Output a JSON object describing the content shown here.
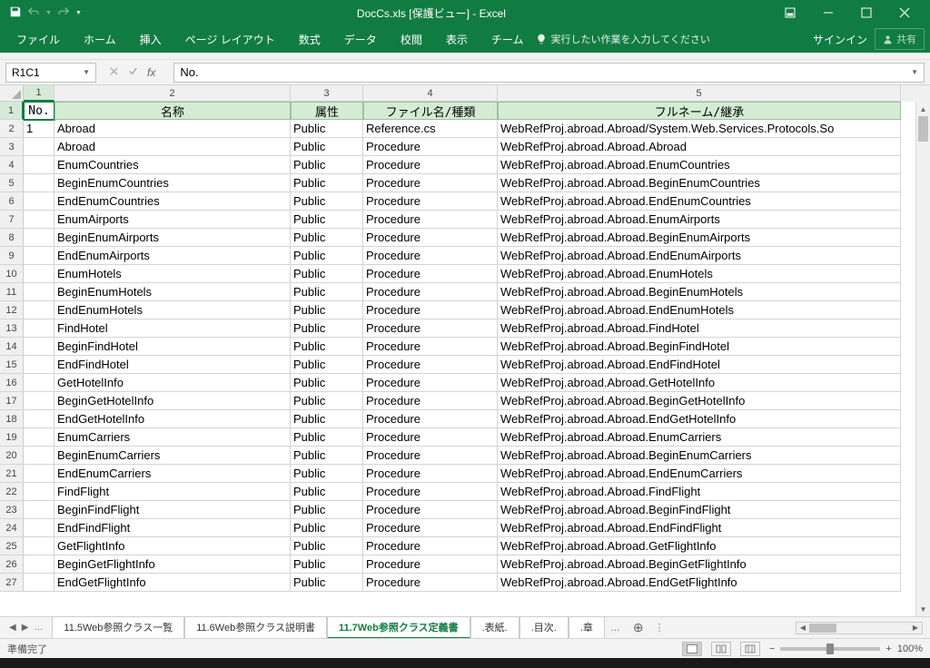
{
  "title": "DocCs.xls  [保護ビュー] - Excel",
  "ribbon": {
    "tabs": [
      "ファイル",
      "ホーム",
      "挿入",
      "ページ レイアウト",
      "数式",
      "データ",
      "校閲",
      "表示",
      "チーム"
    ],
    "tell": "実行したい作業を入力してください",
    "signin": "サインイン",
    "share": "共有"
  },
  "namebox": "R1C1",
  "formula": "No.",
  "colheaders": [
    "1",
    "2",
    "3",
    "4",
    "5"
  ],
  "header_row": [
    "No.",
    "名称",
    "属性",
    "ファイル名/種類",
    "フルネーム/継承"
  ],
  "rows": [
    [
      "1",
      "Abroad",
      "Public",
      "Reference.cs",
      "WebRefProj.abroad.Abroad/System.Web.Services.Protocols.So"
    ],
    [
      "",
      "Abroad",
      "Public",
      "Procedure",
      "WebRefProj.abroad.Abroad.Abroad"
    ],
    [
      "",
      "EnumCountries",
      "Public",
      "Procedure",
      "WebRefProj.abroad.Abroad.EnumCountries"
    ],
    [
      "",
      "BeginEnumCountries",
      "Public",
      "Procedure",
      "WebRefProj.abroad.Abroad.BeginEnumCountries"
    ],
    [
      "",
      "EndEnumCountries",
      "Public",
      "Procedure",
      "WebRefProj.abroad.Abroad.EndEnumCountries"
    ],
    [
      "",
      "EnumAirports",
      "Public",
      "Procedure",
      "WebRefProj.abroad.Abroad.EnumAirports"
    ],
    [
      "",
      "BeginEnumAirports",
      "Public",
      "Procedure",
      "WebRefProj.abroad.Abroad.BeginEnumAirports"
    ],
    [
      "",
      "EndEnumAirports",
      "Public",
      "Procedure",
      "WebRefProj.abroad.Abroad.EndEnumAirports"
    ],
    [
      "",
      "EnumHotels",
      "Public",
      "Procedure",
      "WebRefProj.abroad.Abroad.EnumHotels"
    ],
    [
      "",
      "BeginEnumHotels",
      "Public",
      "Procedure",
      "WebRefProj.abroad.Abroad.BeginEnumHotels"
    ],
    [
      "",
      "EndEnumHotels",
      "Public",
      "Procedure",
      "WebRefProj.abroad.Abroad.EndEnumHotels"
    ],
    [
      "",
      "FindHotel",
      "Public",
      "Procedure",
      "WebRefProj.abroad.Abroad.FindHotel"
    ],
    [
      "",
      "BeginFindHotel",
      "Public",
      "Procedure",
      "WebRefProj.abroad.Abroad.BeginFindHotel"
    ],
    [
      "",
      "EndFindHotel",
      "Public",
      "Procedure",
      "WebRefProj.abroad.Abroad.EndFindHotel"
    ],
    [
      "",
      "GetHotelInfo",
      "Public",
      "Procedure",
      "WebRefProj.abroad.Abroad.GetHotelInfo"
    ],
    [
      "",
      "BeginGetHotelInfo",
      "Public",
      "Procedure",
      "WebRefProj.abroad.Abroad.BeginGetHotelInfo"
    ],
    [
      "",
      "EndGetHotelInfo",
      "Public",
      "Procedure",
      "WebRefProj.abroad.Abroad.EndGetHotelInfo"
    ],
    [
      "",
      "EnumCarriers",
      "Public",
      "Procedure",
      "WebRefProj.abroad.Abroad.EnumCarriers"
    ],
    [
      "",
      "BeginEnumCarriers",
      "Public",
      "Procedure",
      "WebRefProj.abroad.Abroad.BeginEnumCarriers"
    ],
    [
      "",
      "EndEnumCarriers",
      "Public",
      "Procedure",
      "WebRefProj.abroad.Abroad.EndEnumCarriers"
    ],
    [
      "",
      "FindFlight",
      "Public",
      "Procedure",
      "WebRefProj.abroad.Abroad.FindFlight"
    ],
    [
      "",
      "BeginFindFlight",
      "Public",
      "Procedure",
      "WebRefProj.abroad.Abroad.BeginFindFlight"
    ],
    [
      "",
      "EndFindFlight",
      "Public",
      "Procedure",
      "WebRefProj.abroad.Abroad.EndFindFlight"
    ],
    [
      "",
      "GetFlightInfo",
      "Public",
      "Procedure",
      "WebRefProj.abroad.Abroad.GetFlightInfo"
    ],
    [
      "",
      "BeginGetFlightInfo",
      "Public",
      "Procedure",
      "WebRefProj.abroad.Abroad.BeginGetFlightInfo"
    ],
    [
      "",
      "EndGetFlightInfo",
      "Public",
      "Procedure",
      "WebRefProj.abroad.Abroad.EndGetFlightInfo"
    ]
  ],
  "sheets": {
    "tabs": [
      "11.5Web参照クラス一覧",
      "11.6Web参照クラス説明書",
      "11.7Web参照クラス定義書",
      ".表紙.",
      ".目次.",
      ".章 "
    ],
    "active_index": 2
  },
  "status": {
    "ready": "準備完了",
    "zoom": "100%"
  }
}
